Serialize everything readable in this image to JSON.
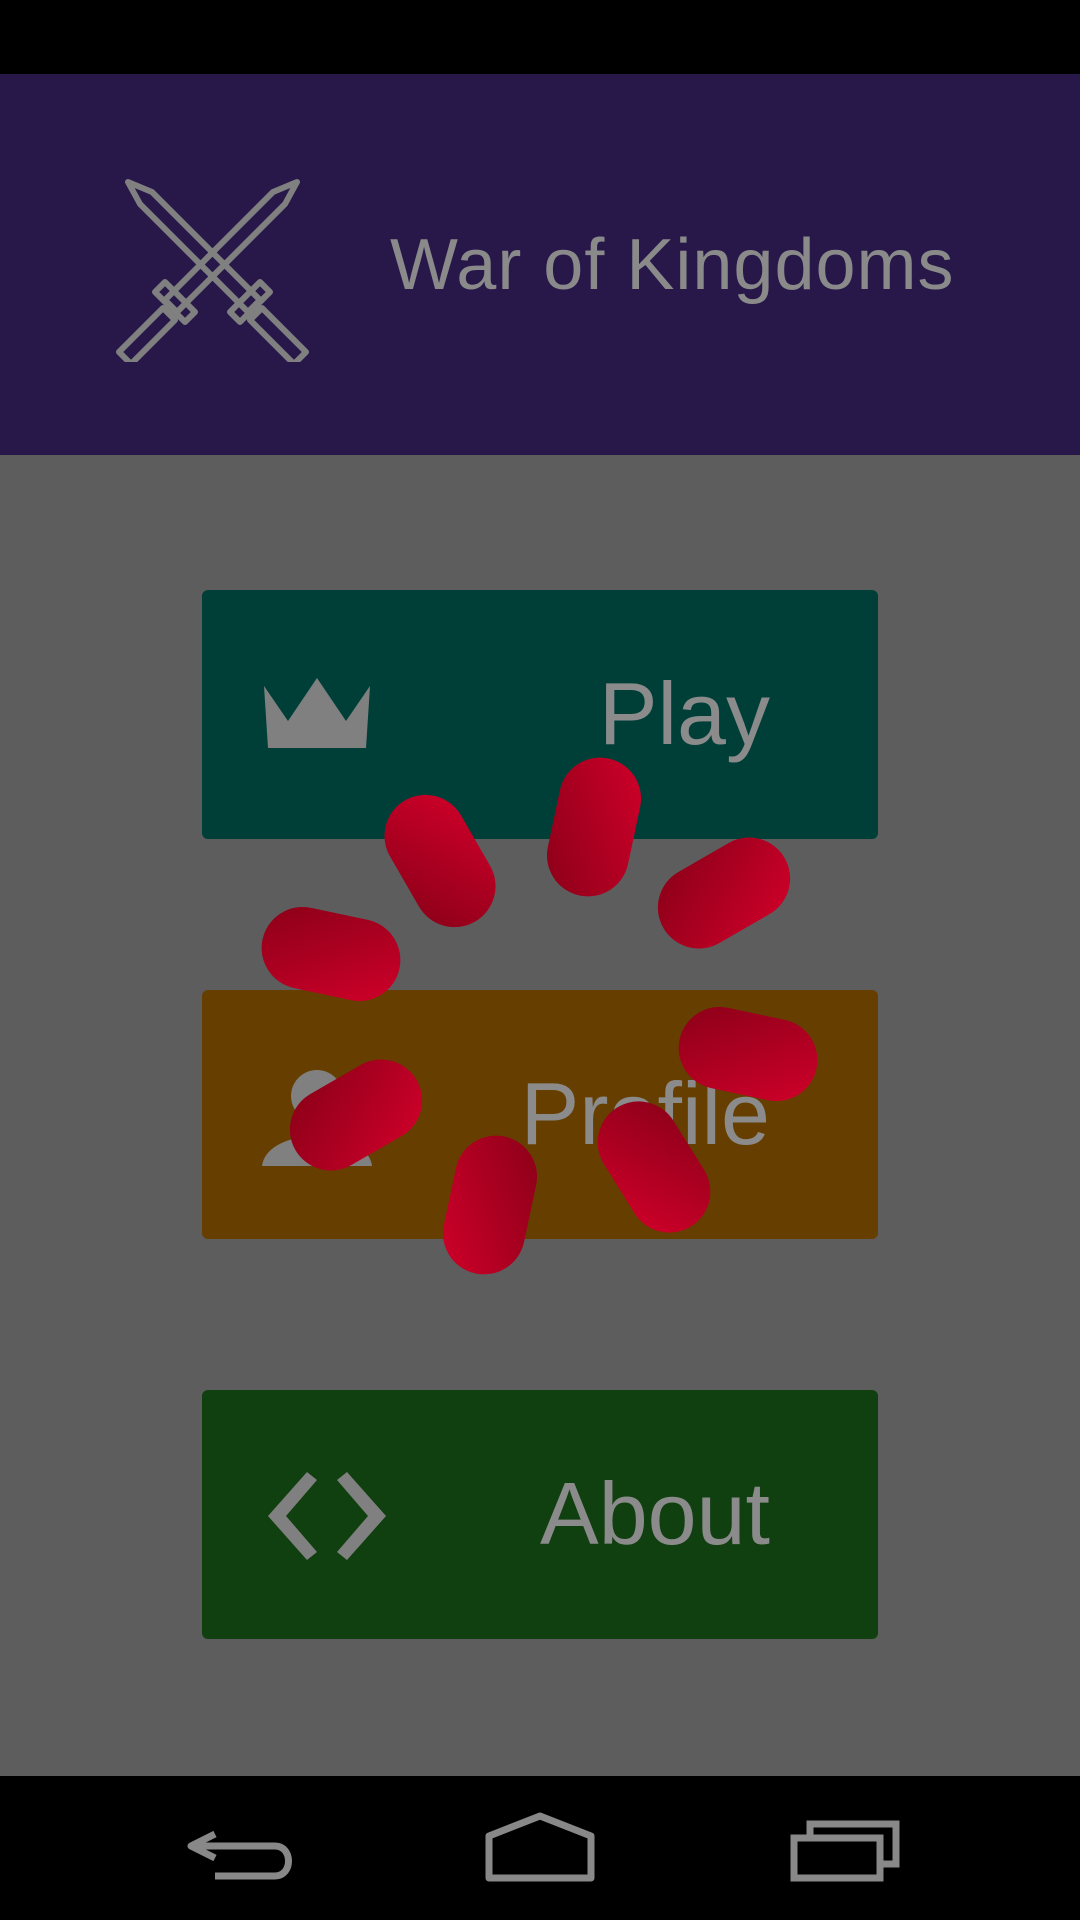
{
  "app": {
    "title": "War of Kingdoms"
  },
  "menu": {
    "play_label": "Play",
    "profile_label": "Profile",
    "about_label": "About"
  },
  "icons": {
    "header": "crossed-swords-icon",
    "play": "crown-icon",
    "profile": "person-icon",
    "about": "code-brackets-icon",
    "loading": "loading-spinner",
    "nav_back": "back-arrow-icon",
    "nav_home": "home-icon",
    "nav_recents": "recent-apps-icon"
  },
  "colors": {
    "header_bg": "#28184a",
    "play_bg": "#003f38",
    "profile_bg": "#663f00",
    "about_bg": "#103f10",
    "spinner": "#c8001e",
    "overlay_text": "#8b8b8b"
  }
}
